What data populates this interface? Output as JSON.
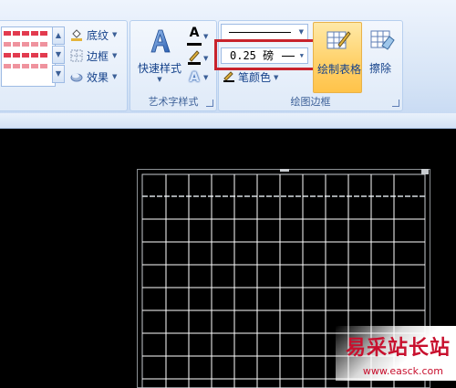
{
  "ribbon": {
    "shading_label": "底纹",
    "borders_label": "边框",
    "effects_label": "效果",
    "quick_styles_label": "快速样式",
    "art_text_group": "艺术字样式",
    "draw_borders_group": "绘图边框",
    "pen_weight_value": "0.25 磅",
    "pen_color_label": "笔颜色",
    "draw_table_label": "绘制表格",
    "eraser_label": "擦除"
  },
  "watermark": {
    "title": "易采站长站",
    "url": "www.easck.com"
  },
  "colors": {
    "highlight": "#c8232c",
    "ribbon_text": "#15428b",
    "table_red": "#e23b4f",
    "active_button": "#ffd26b"
  }
}
